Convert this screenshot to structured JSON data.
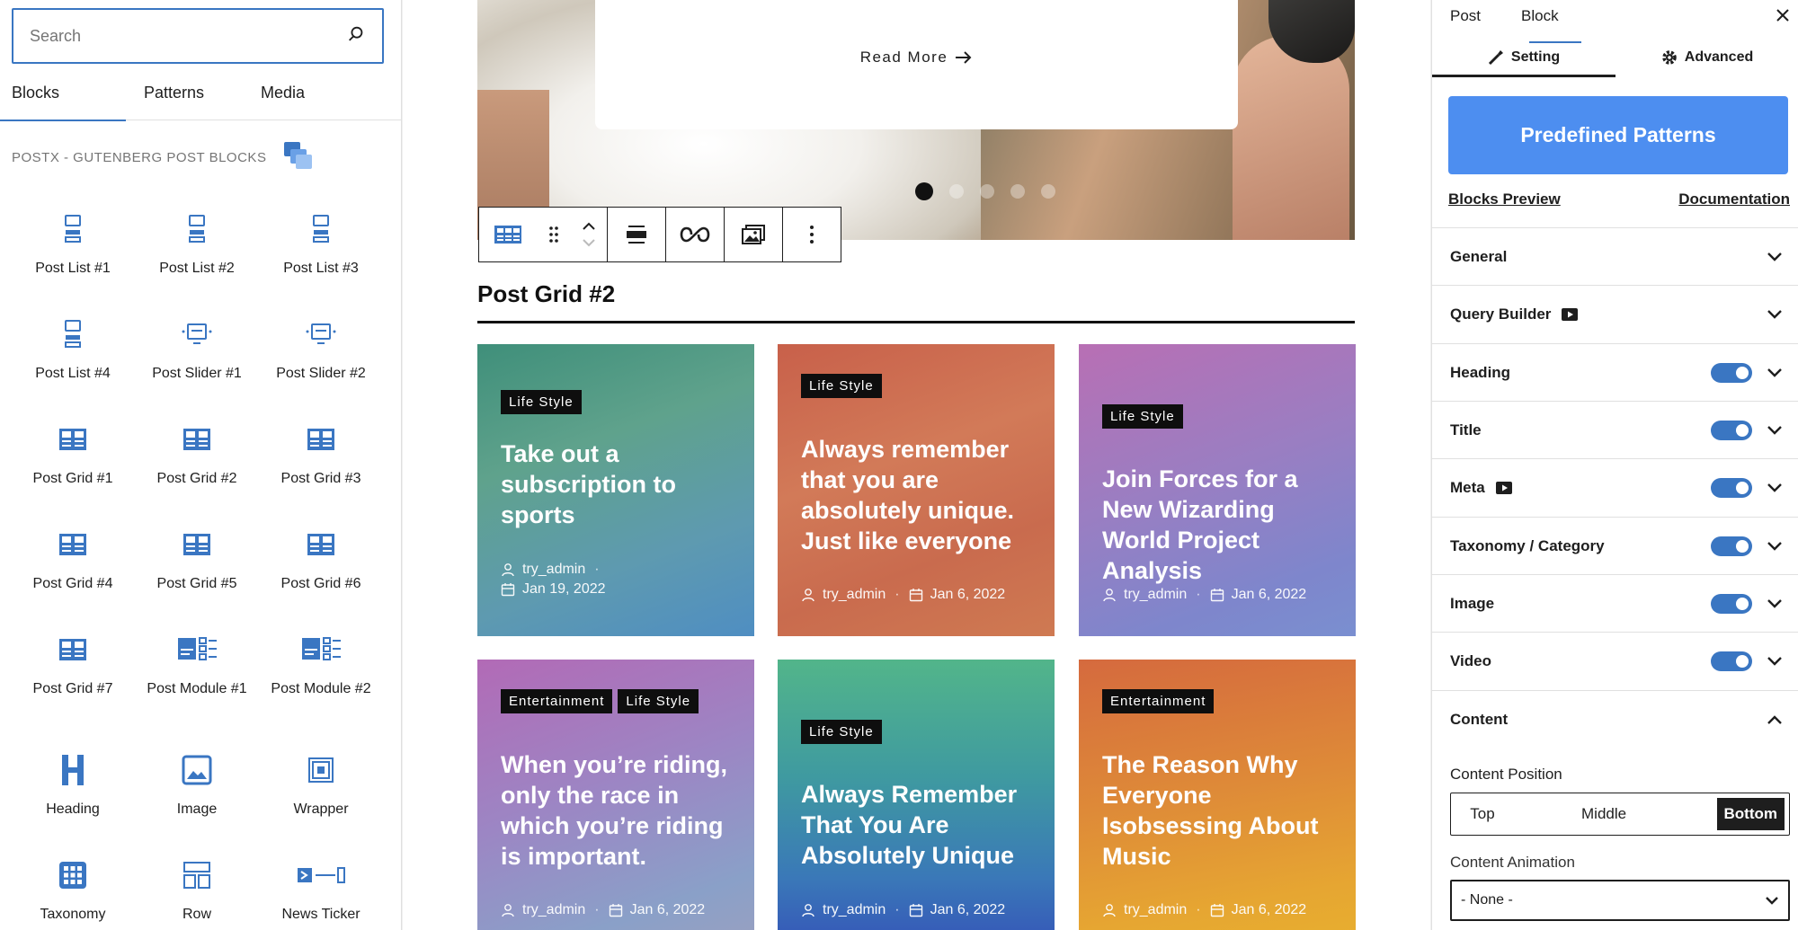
{
  "sidebar_left": {
    "search_placeholder": "Search",
    "tabs": [
      {
        "label": "Blocks"
      },
      {
        "label": "Patterns"
      },
      {
        "label": "Media"
      }
    ],
    "category_title": "POSTX - GUTENBERG POST BLOCKS",
    "blocks": [
      {
        "label": "Post List #1",
        "icon": "post-list-icon"
      },
      {
        "label": "Post List #2",
        "icon": "post-list-icon"
      },
      {
        "label": "Post List #3",
        "icon": "post-list-icon"
      },
      {
        "label": "Post List #4",
        "icon": "post-list-icon"
      },
      {
        "label": "Post Slider #1",
        "icon": "post-slider-icon"
      },
      {
        "label": "Post Slider #2",
        "icon": "post-slider-icon"
      },
      {
        "label": "Post Grid #1",
        "icon": "post-grid-icon"
      },
      {
        "label": "Post Grid #2",
        "icon": "post-grid-icon"
      },
      {
        "label": "Post Grid #3",
        "icon": "post-grid-icon"
      },
      {
        "label": "Post Grid #4",
        "icon": "post-grid-icon"
      },
      {
        "label": "Post Grid #5",
        "icon": "post-grid-icon"
      },
      {
        "label": "Post Grid #6",
        "icon": "post-grid-icon"
      },
      {
        "label": "Post Grid #7",
        "icon": "post-grid-icon"
      },
      {
        "label": "Post Module #1",
        "icon": "post-module-icon"
      },
      {
        "label": "Post Module #2",
        "icon": "post-module-icon"
      },
      {
        "label": "Heading",
        "icon": "heading-icon"
      },
      {
        "label": "Image",
        "icon": "image-icon"
      },
      {
        "label": "Wrapper",
        "icon": "wrapper-icon"
      },
      {
        "label": "Taxonomy",
        "icon": "taxonomy-icon"
      },
      {
        "label": "Row",
        "icon": "row-icon"
      },
      {
        "label": "News Ticker",
        "icon": "news-ticker-icon"
      }
    ]
  },
  "canvas": {
    "slider": {
      "read_more_label": "Read More",
      "slide_count": 5,
      "active_slide": 1
    },
    "toolbar": {
      "icons": [
        "block-type-icon",
        "drag-handle-icon",
        "move-up-down-icon",
        "align-icon",
        "link-icon",
        "featured-image-icon",
        "more-options-icon"
      ]
    },
    "grid_heading": "Post Grid #2",
    "posts": [
      {
        "tags": [
          "Life Style"
        ],
        "title": "Take out a subscription to sports",
        "author": "try_admin",
        "date": "Jan 19, 2022"
      },
      {
        "tags": [
          "Life Style"
        ],
        "title": "Always remember that you are absolutely unique. Just like everyone",
        "author": "try_admin",
        "date": "Jan 6, 2022"
      },
      {
        "tags": [
          "Life Style"
        ],
        "title": "Join Forces for a New Wizarding World Project Analysis",
        "author": "try_admin",
        "date": "Jan 6, 2022"
      },
      {
        "tags": [
          "Entertainment",
          "Life Style"
        ],
        "title": "When you’re riding, only the race in which you’re riding is important.",
        "author": "try_admin",
        "date": "Jan 6, 2022"
      },
      {
        "tags": [
          "Life Style"
        ],
        "title": "Always Remember That You Are Absolutely Unique",
        "author": "try_admin",
        "date": "Jan 6, 2022"
      },
      {
        "tags": [
          "Entertainment"
        ],
        "title": "The Reason Why Everyone Isobsessing About Music",
        "author": "try_admin",
        "date": "Jan 6, 2022"
      }
    ]
  },
  "sidebar_right": {
    "top_tabs": [
      {
        "label": "Post"
      },
      {
        "label": "Block"
      }
    ],
    "sub_tabs": [
      {
        "label": "Setting",
        "icon": "wrench-icon"
      },
      {
        "label": "Advanced",
        "icon": "gear-icon"
      }
    ],
    "predefined_label": "Predefined Patterns",
    "blocks_preview_label": "Blocks Preview",
    "documentation_label": "Documentation",
    "sections": [
      {
        "label": "General",
        "toggle": null,
        "video": false,
        "expanded": false
      },
      {
        "label": "Query Builder",
        "toggle": null,
        "video": true,
        "expanded": false
      },
      {
        "label": "Heading",
        "toggle": true,
        "video": false,
        "expanded": false
      },
      {
        "label": "Title",
        "toggle": true,
        "video": false,
        "expanded": false
      },
      {
        "label": "Meta",
        "toggle": true,
        "video": true,
        "expanded": false
      },
      {
        "label": "Taxonomy / Category",
        "toggle": true,
        "video": false,
        "expanded": false
      },
      {
        "label": "Image",
        "toggle": true,
        "video": false,
        "expanded": false
      },
      {
        "label": "Video",
        "toggle": true,
        "video": false,
        "expanded": false
      },
      {
        "label": "Content",
        "toggle": null,
        "video": false,
        "expanded": true
      }
    ],
    "content_position_label": "Content Position",
    "content_position_options": [
      "Top",
      "Middle",
      "Bottom"
    ],
    "content_position_selected": "Bottom",
    "content_animation_label": "Content Animation",
    "content_animation_value": "- None -"
  },
  "colors": {
    "accent": "#3a76c2",
    "predefined_button": "#4d8ef0",
    "block_icon": "#3a76c2"
  }
}
